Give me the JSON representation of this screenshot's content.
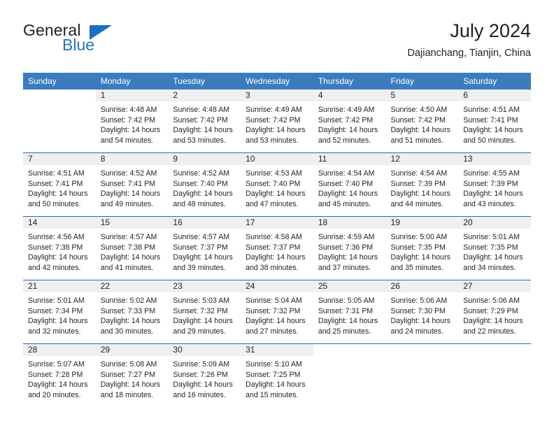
{
  "brand": {
    "word_one": "General",
    "word_two": "Blue",
    "accent_color": "#1b6fc0"
  },
  "header": {
    "title": "July 2024",
    "subtitle": "Dajianchang, Tianjin, China",
    "header_bg": "#3a7cbe",
    "daynum_bg": "#efefef",
    "separator_color": "#1b6fc0"
  },
  "weekday_headers": [
    "Sunday",
    "Monday",
    "Tuesday",
    "Wednesday",
    "Thursday",
    "Friday",
    "Saturday"
  ],
  "weeks": [
    [
      {
        "day": "",
        "lines": []
      },
      {
        "day": "1",
        "lines": [
          "Sunrise: 4:48 AM",
          "Sunset: 7:42 PM",
          "Daylight: 14 hours",
          "and 54 minutes."
        ]
      },
      {
        "day": "2",
        "lines": [
          "Sunrise: 4:48 AM",
          "Sunset: 7:42 PM",
          "Daylight: 14 hours",
          "and 53 minutes."
        ]
      },
      {
        "day": "3",
        "lines": [
          "Sunrise: 4:49 AM",
          "Sunset: 7:42 PM",
          "Daylight: 14 hours",
          "and 53 minutes."
        ]
      },
      {
        "day": "4",
        "lines": [
          "Sunrise: 4:49 AM",
          "Sunset: 7:42 PM",
          "Daylight: 14 hours",
          "and 52 minutes."
        ]
      },
      {
        "day": "5",
        "lines": [
          "Sunrise: 4:50 AM",
          "Sunset: 7:42 PM",
          "Daylight: 14 hours",
          "and 51 minutes."
        ]
      },
      {
        "day": "6",
        "lines": [
          "Sunrise: 4:51 AM",
          "Sunset: 7:41 PM",
          "Daylight: 14 hours",
          "and 50 minutes."
        ]
      }
    ],
    [
      {
        "day": "7",
        "lines": [
          "Sunrise: 4:51 AM",
          "Sunset: 7:41 PM",
          "Daylight: 14 hours",
          "and 50 minutes."
        ]
      },
      {
        "day": "8",
        "lines": [
          "Sunrise: 4:52 AM",
          "Sunset: 7:41 PM",
          "Daylight: 14 hours",
          "and 49 minutes."
        ]
      },
      {
        "day": "9",
        "lines": [
          "Sunrise: 4:52 AM",
          "Sunset: 7:40 PM",
          "Daylight: 14 hours",
          "and 48 minutes."
        ]
      },
      {
        "day": "10",
        "lines": [
          "Sunrise: 4:53 AM",
          "Sunset: 7:40 PM",
          "Daylight: 14 hours",
          "and 47 minutes."
        ]
      },
      {
        "day": "11",
        "lines": [
          "Sunrise: 4:54 AM",
          "Sunset: 7:40 PM",
          "Daylight: 14 hours",
          "and 45 minutes."
        ]
      },
      {
        "day": "12",
        "lines": [
          "Sunrise: 4:54 AM",
          "Sunset: 7:39 PM",
          "Daylight: 14 hours",
          "and 44 minutes."
        ]
      },
      {
        "day": "13",
        "lines": [
          "Sunrise: 4:55 AM",
          "Sunset: 7:39 PM",
          "Daylight: 14 hours",
          "and 43 minutes."
        ]
      }
    ],
    [
      {
        "day": "14",
        "lines": [
          "Sunrise: 4:56 AM",
          "Sunset: 7:38 PM",
          "Daylight: 14 hours",
          "and 42 minutes."
        ]
      },
      {
        "day": "15",
        "lines": [
          "Sunrise: 4:57 AM",
          "Sunset: 7:38 PM",
          "Daylight: 14 hours",
          "and 41 minutes."
        ]
      },
      {
        "day": "16",
        "lines": [
          "Sunrise: 4:57 AM",
          "Sunset: 7:37 PM",
          "Daylight: 14 hours",
          "and 39 minutes."
        ]
      },
      {
        "day": "17",
        "lines": [
          "Sunrise: 4:58 AM",
          "Sunset: 7:37 PM",
          "Daylight: 14 hours",
          "and 38 minutes."
        ]
      },
      {
        "day": "18",
        "lines": [
          "Sunrise: 4:59 AM",
          "Sunset: 7:36 PM",
          "Daylight: 14 hours",
          "and 37 minutes."
        ]
      },
      {
        "day": "19",
        "lines": [
          "Sunrise: 5:00 AM",
          "Sunset: 7:35 PM",
          "Daylight: 14 hours",
          "and 35 minutes."
        ]
      },
      {
        "day": "20",
        "lines": [
          "Sunrise: 5:01 AM",
          "Sunset: 7:35 PM",
          "Daylight: 14 hours",
          "and 34 minutes."
        ]
      }
    ],
    [
      {
        "day": "21",
        "lines": [
          "Sunrise: 5:01 AM",
          "Sunset: 7:34 PM",
          "Daylight: 14 hours",
          "and 32 minutes."
        ]
      },
      {
        "day": "22",
        "lines": [
          "Sunrise: 5:02 AM",
          "Sunset: 7:33 PM",
          "Daylight: 14 hours",
          "and 30 minutes."
        ]
      },
      {
        "day": "23",
        "lines": [
          "Sunrise: 5:03 AM",
          "Sunset: 7:32 PM",
          "Daylight: 14 hours",
          "and 29 minutes."
        ]
      },
      {
        "day": "24",
        "lines": [
          "Sunrise: 5:04 AM",
          "Sunset: 7:32 PM",
          "Daylight: 14 hours",
          "and 27 minutes."
        ]
      },
      {
        "day": "25",
        "lines": [
          "Sunrise: 5:05 AM",
          "Sunset: 7:31 PM",
          "Daylight: 14 hours",
          "and 25 minutes."
        ]
      },
      {
        "day": "26",
        "lines": [
          "Sunrise: 5:06 AM",
          "Sunset: 7:30 PM",
          "Daylight: 14 hours",
          "and 24 minutes."
        ]
      },
      {
        "day": "27",
        "lines": [
          "Sunrise: 5:06 AM",
          "Sunset: 7:29 PM",
          "Daylight: 14 hours",
          "and 22 minutes."
        ]
      }
    ],
    [
      {
        "day": "28",
        "lines": [
          "Sunrise: 5:07 AM",
          "Sunset: 7:28 PM",
          "Daylight: 14 hours",
          "and 20 minutes."
        ]
      },
      {
        "day": "29",
        "lines": [
          "Sunrise: 5:08 AM",
          "Sunset: 7:27 PM",
          "Daylight: 14 hours",
          "and 18 minutes."
        ]
      },
      {
        "day": "30",
        "lines": [
          "Sunrise: 5:09 AM",
          "Sunset: 7:26 PM",
          "Daylight: 14 hours",
          "and 16 minutes."
        ]
      },
      {
        "day": "31",
        "lines": [
          "Sunrise: 5:10 AM",
          "Sunset: 7:25 PM",
          "Daylight: 14 hours",
          "and 15 minutes."
        ]
      },
      {
        "day": "",
        "lines": []
      },
      {
        "day": "",
        "lines": []
      },
      {
        "day": "",
        "lines": []
      }
    ]
  ]
}
